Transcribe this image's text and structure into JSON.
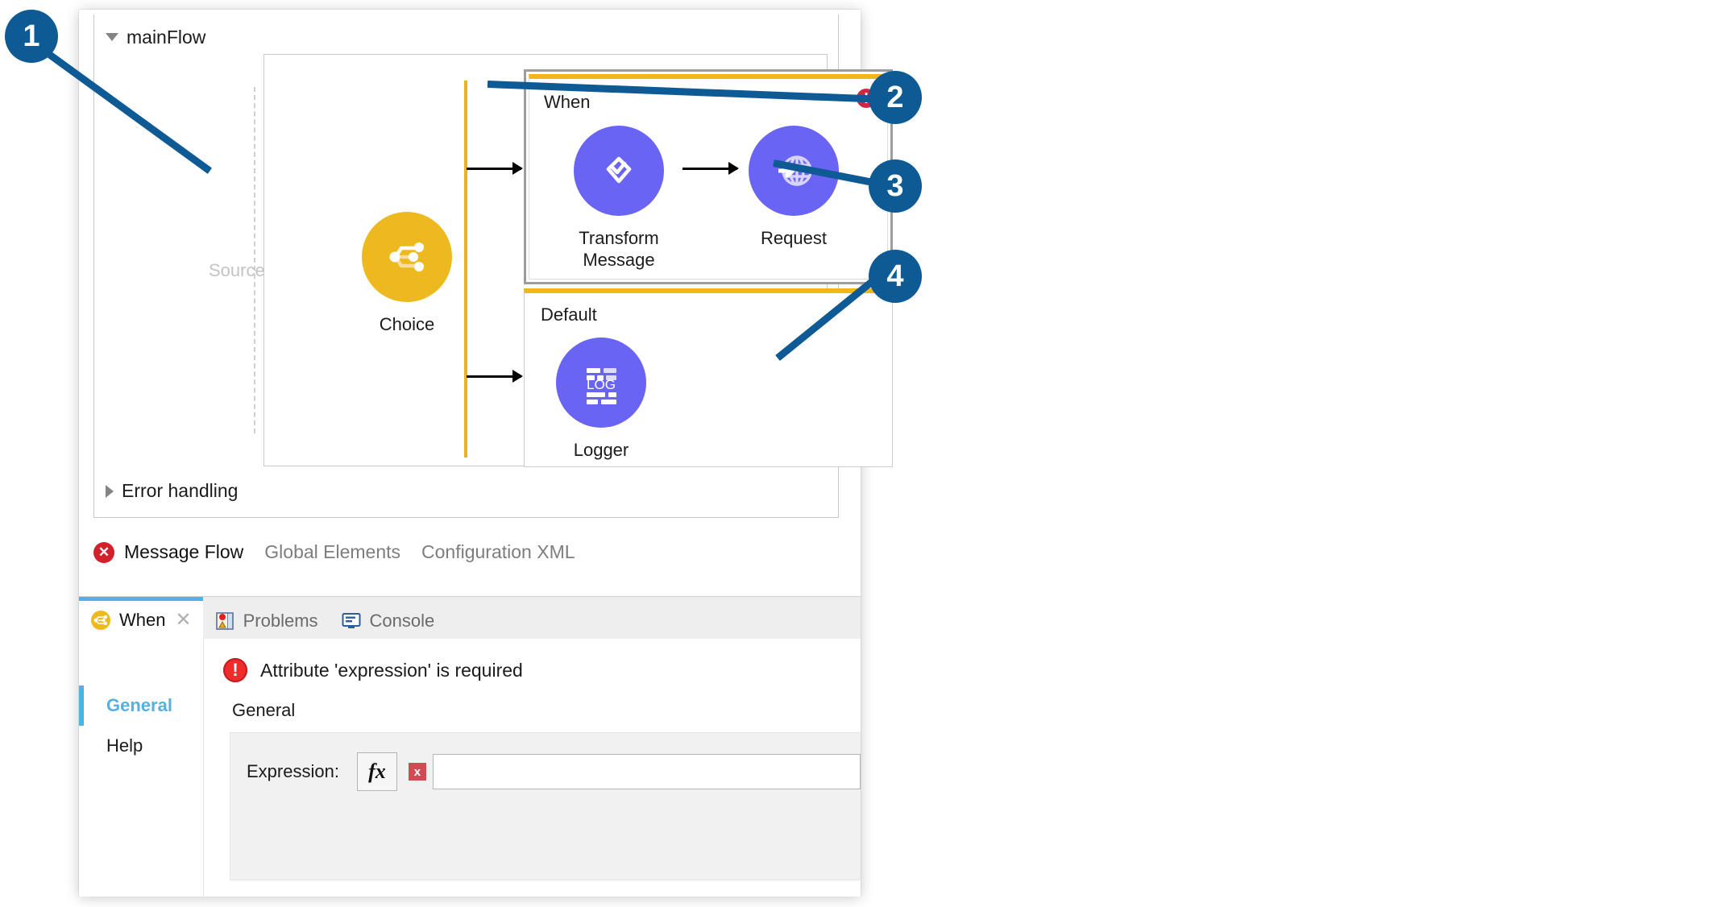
{
  "flow": {
    "name": "mainFlow",
    "source_label": "Source",
    "error_handling_label": "Error handling",
    "when_label": "When",
    "default_label": "Default",
    "error_badge_glyph": "!",
    "nodes": {
      "choice": {
        "label": "Choice",
        "icon": "choice-router-icon",
        "color": "#eeb81f"
      },
      "transform": {
        "label": "Transform\nMessage",
        "label_line1": "Transform",
        "label_line2": "Message",
        "icon": "transform-message-icon",
        "color": "#6a64f5"
      },
      "request": {
        "label": "Request",
        "icon": "http-request-globe-icon",
        "color": "#6a64f5"
      },
      "logger": {
        "label": "Logger",
        "icon": "logger-log-icon",
        "color": "#6a64f5",
        "glyph": "LOG"
      }
    }
  },
  "editor_tabs": [
    {
      "label": "Message Flow",
      "active": true,
      "icon": "error-x-icon"
    },
    {
      "label": "Global Elements",
      "active": false,
      "icon": ""
    },
    {
      "label": "Configuration XML",
      "active": false,
      "icon": ""
    }
  ],
  "properties": {
    "tabs": [
      {
        "label": "When",
        "active": true,
        "icon": "choice-when-icon",
        "closable": true,
        "close_glyph": "✕"
      },
      {
        "label": "Problems",
        "active": false,
        "icon": "problems-icon",
        "closable": false
      },
      {
        "label": "Console",
        "active": false,
        "icon": "console-monitor-icon",
        "closable": false
      }
    ],
    "nav": [
      {
        "label": "General",
        "active": true
      },
      {
        "label": "Help",
        "active": false
      }
    ],
    "error_message": "Attribute 'expression' is required",
    "error_glyph": "!",
    "section_title": "General",
    "expression_field": {
      "label": "Expression:",
      "fx_button": "fx",
      "invalid_marker": "x",
      "value": "",
      "placeholder": ""
    }
  },
  "callouts": [
    {
      "number": "1"
    },
    {
      "number": "2"
    },
    {
      "number": "3"
    },
    {
      "number": "4"
    }
  ],
  "colors": {
    "accent_blue": "#0d5a94",
    "flow_top_blue": "#2a8fd4",
    "yellow": "#edb21f",
    "purple": "#6a64f5",
    "error_red": "#cf2744",
    "tab_active_blue": "#4db2e8"
  }
}
